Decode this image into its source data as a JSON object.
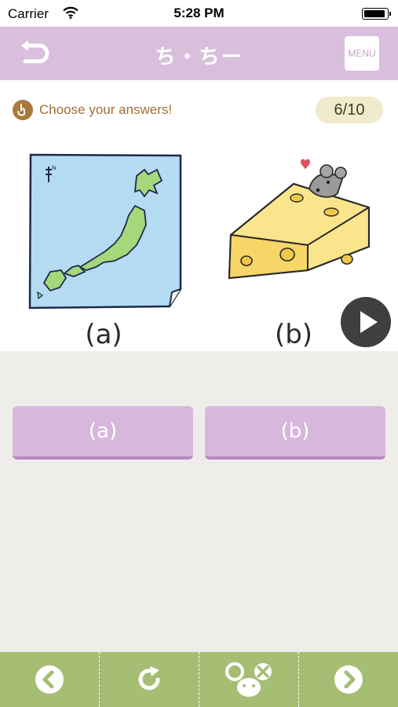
{
  "status_bar": {
    "carrier": "Carrier",
    "time": "5:28 PM"
  },
  "header": {
    "title": "ち・ちー",
    "menu_label": "MENU"
  },
  "quiz": {
    "instruction": "Choose your answers!",
    "progress": "6/10",
    "option_a_label": "(a)",
    "option_b_label": "(b)",
    "option_a_image": "japan-map",
    "option_b_image": "mouse-on-cheese"
  },
  "answers": {
    "a_label": "(a)",
    "b_label": "(b)"
  },
  "toolbar": {
    "items": [
      "previous-icon",
      "retry-icon",
      "quiz-mascot-icon",
      "next-icon"
    ]
  },
  "colors": {
    "header": "#d8bfdb",
    "toolbar": "#a6bd74",
    "answer_button": "#d7b8dc",
    "progress_badge": "#f0ebcc"
  }
}
